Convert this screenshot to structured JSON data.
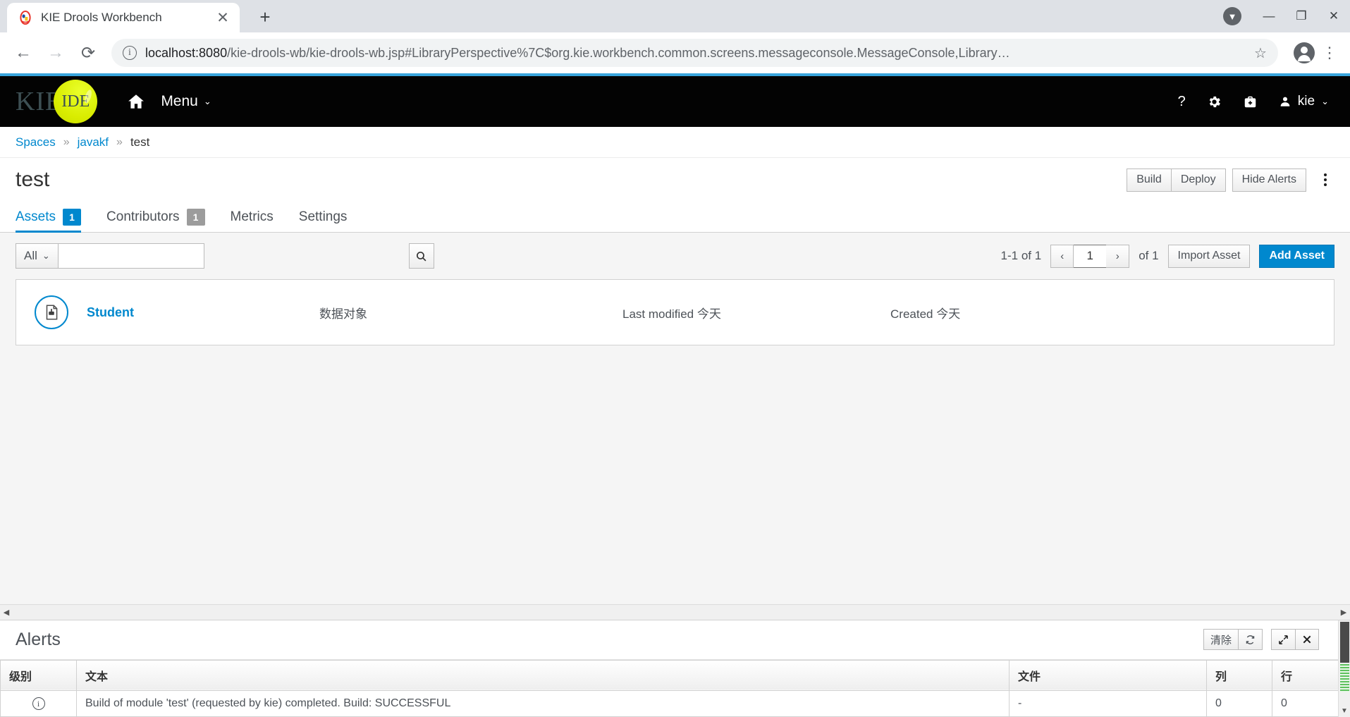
{
  "browser": {
    "tab_title": "KIE Drools Workbench",
    "tab_close": "✕",
    "new_tab": "+",
    "back": "←",
    "forward": "→",
    "reload": "⟳",
    "url_host": "localhost:8080",
    "url_path": "/kie-drools-wb/kie-drools-wb.jsp#LibraryPerspective%7C$org.kie.workbench.common.screens.messageconsole.MessageConsole,Library…",
    "star": "☆",
    "menu": "⋮",
    "extension_badge": "▼",
    "minimize": "—",
    "maximize": "❐",
    "close": "✕"
  },
  "masthead": {
    "brand_kie": "KIE",
    "brand_ide": "IDE",
    "home_icon": "home-icon",
    "menu_label": "Menu",
    "menu_chevron": "⌄",
    "help_icon": "?",
    "settings_icon": "⚙",
    "toolbox_icon": "toolbox-icon",
    "user_label": "kie",
    "user_chevron": "⌄"
  },
  "breadcrumb": {
    "items": [
      {
        "label": "Spaces",
        "link": true
      },
      {
        "label": "javakf",
        "link": true
      },
      {
        "label": "test",
        "link": false
      }
    ],
    "separator": "»"
  },
  "title_bar": {
    "title": "test",
    "buttons": [
      "Build",
      "Deploy"
    ],
    "hide_alerts": "Hide Alerts",
    "kebab": "⋮"
  },
  "tabs": [
    {
      "label": "Assets",
      "badge": "1",
      "badge_color": "#0088ce",
      "active": true
    },
    {
      "label": "Contributors",
      "badge": "1",
      "badge_color": "#9c9c9c",
      "active": false
    },
    {
      "label": "Metrics",
      "badge": "",
      "active": false
    },
    {
      "label": "Settings",
      "badge": "",
      "active": false
    }
  ],
  "assets_toolbar": {
    "filter_label": "All",
    "filter_chevron": "⌄",
    "search_value": "",
    "search_placeholder": "",
    "search_icon": "🔍",
    "count_label": "1-1 of 1",
    "prev": "‹",
    "page_value": "1",
    "next": "›",
    "of_label": "of 1",
    "import_asset": "Import Asset",
    "add_asset": "Add Asset"
  },
  "assets": [
    {
      "icon": "data-object-icon",
      "name": "Student",
      "type": "数据对象",
      "last_modified": "Last modified 今天",
      "created": "Created 今天"
    }
  ],
  "alerts": {
    "title": "Alerts",
    "clear_label": "清除",
    "refresh_icon": "⟳",
    "expand_icon": "⤢",
    "close_icon": "✕",
    "columns": [
      "级别",
      "文本",
      "文件",
      "列",
      "行"
    ],
    "rows": [
      {
        "level_icon": "info-icon",
        "text": "Build of module 'test' (requested by kie) completed. Build: SUCCESSFUL",
        "file": "-",
        "column": "0",
        "line": "0"
      }
    ]
  },
  "colors": {
    "accent_blue": "#0088ce",
    "masthead_black": "#030303",
    "brand_yellow": "#d9ec00",
    "rule_blue": "#39a5dc"
  }
}
